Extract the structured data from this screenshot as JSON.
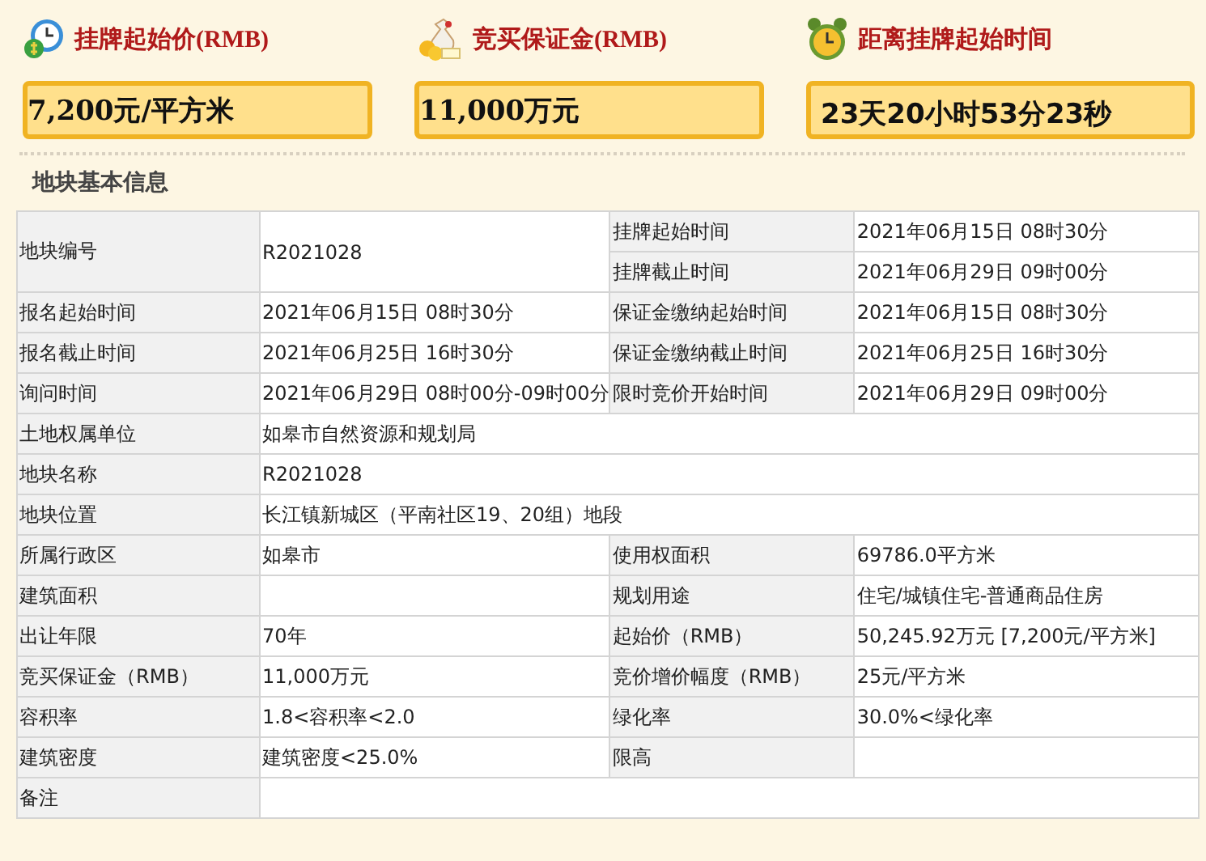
{
  "summary": [
    {
      "kind": "clock",
      "label": "挂牌起始价(RMB)",
      "value": "7,200元/平方米"
    },
    {
      "kind": "money",
      "label": "竞买保证金(RMB)",
      "value": "11,000万元"
    },
    {
      "kind": "alarm",
      "label": "距离挂牌起始时间",
      "value": "23天20小时53分23秒"
    }
  ],
  "section_title": "地块基本信息",
  "rows": [
    {
      "left": {
        "label": "地块编号",
        "value": "R2021028"
      },
      "right": [
        {
          "label": "挂牌起始时间",
          "value": "2021年06月15日 08时30分"
        },
        {
          "label": "挂牌截止时间",
          "value": "2021年06月29日 09时00分"
        }
      ]
    },
    {
      "left": {
        "label": "报名起始时间",
        "value": "2021年06月15日 08时30分"
      },
      "right": [
        {
          "label": "保证金缴纳起始时间",
          "value": "2021年06月15日 08时30分"
        }
      ]
    },
    {
      "left": {
        "label": "报名截止时间",
        "value": "2021年06月25日 16时30分"
      },
      "right": [
        {
          "label": "保证金缴纳截止时间",
          "value": "2021年06月25日 16时30分"
        }
      ]
    },
    {
      "left": {
        "label": "询问时间",
        "value": "2021年06月29日 08时00分-09时00分"
      },
      "right": [
        {
          "label": "限时竞价开始时间",
          "value": "2021年06月29日 09时00分"
        }
      ]
    },
    {
      "left": {
        "label": "土地权属单位",
        "value": "如皋市自然资源和规划局"
      },
      "right": []
    },
    {
      "left": {
        "label": "地块名称",
        "value": "R2021028"
      },
      "right": []
    },
    {
      "left": {
        "label": "地块位置",
        "value": "长江镇新城区（平南社区19、20组）地段"
      },
      "right": []
    },
    {
      "left": {
        "label": "所属行政区",
        "value": "如皋市"
      },
      "right": [
        {
          "label": "使用权面积",
          "value": "69786.0平方米"
        }
      ]
    },
    {
      "left": {
        "label": "建筑面积"
      },
      "right": [
        {
          "label": "规划用途",
          "value": "住宅/城镇住宅-普通商品住房"
        }
      ]
    },
    {
      "left": {
        "label": "出让年限",
        "value": "70年"
      },
      "right": [
        {
          "label": "起始价（RMB）",
          "value": "50,245.92万元 [7,200元/平方米]"
        }
      ]
    },
    {
      "left": {
        "label": "竞买保证金（RMB）",
        "value": "11,000万元"
      },
      "right": [
        {
          "label": "竞价增价幅度（RMB）",
          "value": "25元/平方米"
        }
      ]
    },
    {
      "left": {
        "label": "容积率",
        "value": "1.8<容积率<2.0"
      },
      "right": [
        {
          "label": "绿化率",
          "value": "30.0%<绿化率"
        }
      ]
    },
    {
      "left": {
        "label": "建筑密度",
        "value": "建筑密度<25.0%"
      },
      "right": [
        {
          "label": "限高"
        }
      ]
    },
    {
      "left": {
        "label": "备注"
      },
      "right": []
    }
  ]
}
